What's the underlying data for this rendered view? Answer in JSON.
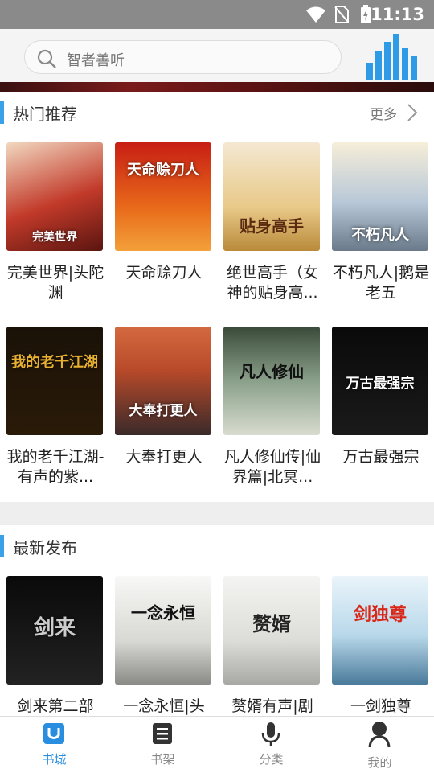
{
  "status": {
    "time": "11:13"
  },
  "search": {
    "placeholder": "智者善听"
  },
  "hot": {
    "title": "热门推荐",
    "more": "更多",
    "books": [
      {
        "name": "完美世界|头陀渊",
        "cover_text": "完美世界"
      },
      {
        "name": "天命赊刀人",
        "cover_text": "天命赊刀人"
      },
      {
        "name": "绝世高手（女神的贴身高...",
        "cover_text": "贴身高手"
      },
      {
        "name": "不朽凡人|鹅是老五",
        "cover_text": "不朽凡人"
      },
      {
        "name": "我的老千江湖-有声的紫...",
        "cover_text": "我的老千江湖"
      },
      {
        "name": "大奉打更人",
        "cover_text": "大奉打更人"
      },
      {
        "name": "凡人修仙传|仙界篇|北冥...",
        "cover_text": "凡人修仙"
      },
      {
        "name": "万古最强宗",
        "cover_text": "万古最强宗"
      }
    ]
  },
  "latest": {
    "title": "最新发布",
    "books": [
      {
        "name": "剑来第二部",
        "cover_text": "剑来"
      },
      {
        "name": "一念永恒|头",
        "cover_text": "一念永恒"
      },
      {
        "name": "赘婿有声|剧",
        "cover_text": "赘婿"
      },
      {
        "name": "一剑独尊",
        "cover_text": "剑独尊"
      }
    ]
  },
  "tabs": [
    {
      "label": "书城",
      "icon": "book-city-icon",
      "active": true
    },
    {
      "label": "书架",
      "icon": "bookshelf-icon",
      "active": false
    },
    {
      "label": "分类",
      "icon": "microphone-icon",
      "active": false
    },
    {
      "label": "我的",
      "icon": "profile-icon",
      "active": false
    }
  ],
  "colors": {
    "accent": "#3aa0e8",
    "active_tab": "#2a8ee0"
  }
}
